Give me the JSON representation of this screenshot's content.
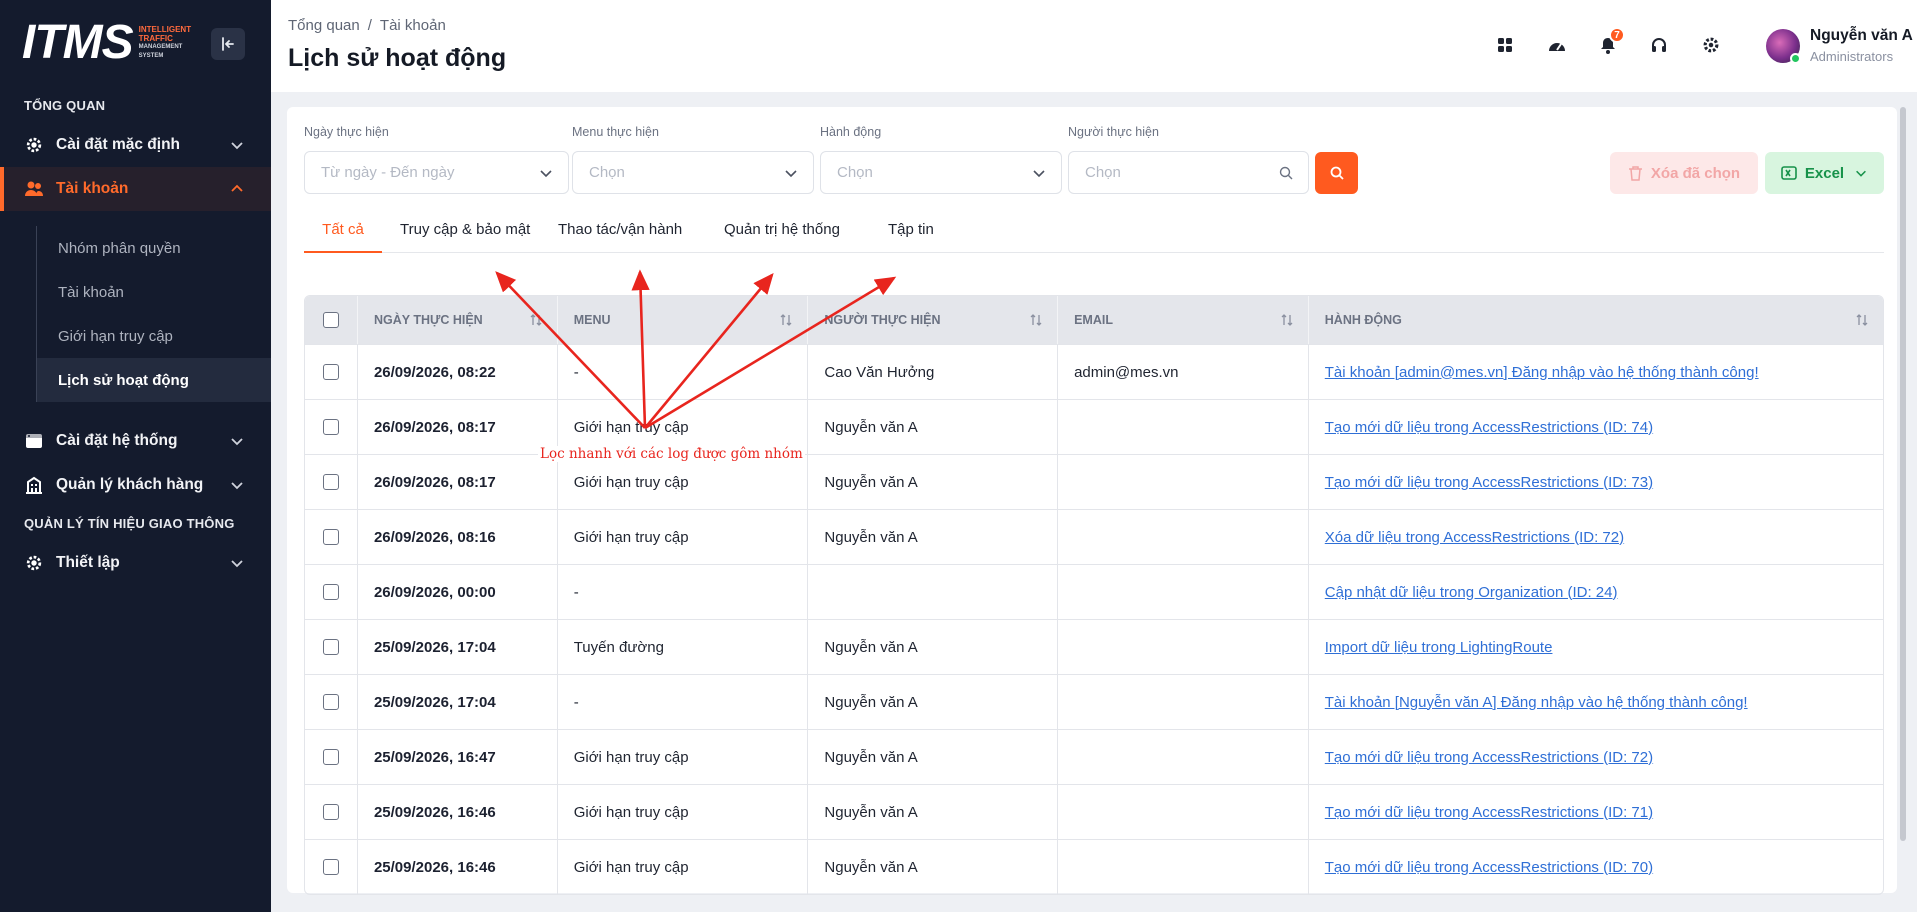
{
  "brand": {
    "mark": "ITMS",
    "sub1": "INTELLIGENT",
    "sub2": "TRAFFIC",
    "sub3": "MANAGEMENT",
    "sub4": "SYSTEM"
  },
  "sidebar": {
    "section_overview": "TỔNG QUAN",
    "section_traffic": "QUẢN LÝ TÍN HIỆU GIAO THÔNG",
    "items": [
      {
        "label": "Cài đặt mặc định",
        "icon": "gear-icon"
      },
      {
        "label": "Tài khoản",
        "icon": "users-icon"
      },
      {
        "label": "Cài đặt hệ thống",
        "icon": "window-icon"
      },
      {
        "label": "Quản lý khách hàng",
        "icon": "building-icon"
      },
      {
        "label": "Thiết lập",
        "icon": "gear-icon"
      }
    ],
    "submenu": [
      "Nhóm phân quyền",
      "Tài khoản",
      "Giới hạn truy cập",
      "Lịch sử hoạt động"
    ]
  },
  "header": {
    "breadcrumb": [
      "Tổng quan",
      "Tài khoản"
    ],
    "title": "Lịch sử hoạt động",
    "notification_count": "7",
    "user_name": "Nguyễn văn A",
    "user_role": "Administrators"
  },
  "filters": {
    "date_label": "Ngày thực hiện",
    "date_placeholder": "Từ ngày - Đến ngày",
    "menu_label": "Menu thực hiện",
    "menu_placeholder": "Chọn",
    "action_label": "Hành động",
    "action_placeholder": "Chọn",
    "user_label": "Người thực hiện",
    "user_placeholder": "Chọn",
    "delete_label": "Xóa đã chọn",
    "excel_label": "Excel"
  },
  "tabs": [
    "Tất cả",
    "Truy cập & bảo mật",
    "Thao tác/vận hành",
    "Quản trị hệ thống",
    "Tập tin"
  ],
  "table": {
    "headers": [
      "NGÀY THỰC HIỆN",
      "MENU",
      "NGƯỜI THỰC HIỆN",
      "EMAIL",
      "HÀNH ĐỘNG"
    ],
    "rows": [
      {
        "date": "26/09/2026, 08:22",
        "menu": "-",
        "user": "Cao Văn Hưởng",
        "email": "admin@mes.vn",
        "action": "Tài khoản [admin@mes.vn] Đăng nhập vào hệ thống thành công!"
      },
      {
        "date": "26/09/2026, 08:17",
        "menu": "Giới hạn truy cập",
        "user": "Nguyễn văn A",
        "email": "",
        "action": "Tạo mới dữ liệu trong AccessRestrictions (ID: 74)"
      },
      {
        "date": "26/09/2026, 08:17",
        "menu": "Giới hạn truy cập",
        "user": "Nguyễn văn A",
        "email": "",
        "action": "Tạo mới dữ liệu trong AccessRestrictions (ID: 73)"
      },
      {
        "date": "26/09/2026, 08:16",
        "menu": "Giới hạn truy cập",
        "user": "Nguyễn văn A",
        "email": "",
        "action": "Xóa dữ liệu trong AccessRestrictions (ID: 72)"
      },
      {
        "date": "26/09/2026, 00:00",
        "menu": "-",
        "user": "",
        "email": "",
        "action": "Cập nhật dữ liệu trong Organization (ID: 24)"
      },
      {
        "date": "25/09/2026, 17:04",
        "menu": "Tuyến đường",
        "user": "Nguyễn văn A",
        "email": "",
        "action": "Import dữ liệu trong LightingRoute"
      },
      {
        "date": "25/09/2026, 17:04",
        "menu": "-",
        "user": "Nguyễn văn A",
        "email": "",
        "action": "Tài khoản [Nguyễn văn A] Đăng nhập vào hệ thống thành công!"
      },
      {
        "date": "25/09/2026, 16:47",
        "menu": "Giới hạn truy cập",
        "user": "Nguyễn văn A",
        "email": "",
        "action": "Tạo mới dữ liệu trong AccessRestrictions (ID: 72)"
      },
      {
        "date": "25/09/2026, 16:46",
        "menu": "Giới hạn truy cập",
        "user": "Nguyễn văn A",
        "email": "",
        "action": "Tạo mới dữ liệu trong AccessRestrictions (ID: 71)"
      },
      {
        "date": "25/09/2026, 16:46",
        "menu": "Giới hạn truy cập",
        "user": "Nguyễn văn A",
        "email": "",
        "action": "Tạo mới dữ liệu trong AccessRestrictions (ID: 70)"
      }
    ]
  },
  "annotation": {
    "text": "Lọc nhanh với các log được gôm nhóm"
  },
  "colors": {
    "accent": "#ff5a1f",
    "sidebar": "#141b2d",
    "link": "#2f6fd6",
    "annotation": "#e8251e"
  }
}
